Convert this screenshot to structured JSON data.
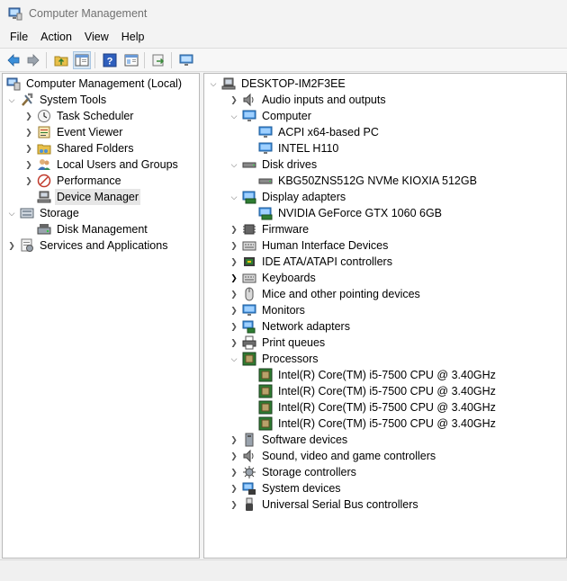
{
  "window": {
    "title": "Computer Management"
  },
  "menu": [
    "File",
    "Action",
    "View",
    "Help"
  ],
  "toolbar": {
    "buttons": [
      "back-arrow-icon",
      "forward-arrow-icon",
      "up-folder-icon",
      "show-hide-console-tree-icon",
      "help-icon",
      "properties-icon",
      "export-list-icon",
      "monitor-icon"
    ]
  },
  "left_tree": {
    "root": "Computer Management (Local)",
    "system_tools": "System Tools",
    "task_scheduler": "Task Scheduler",
    "event_viewer": "Event Viewer",
    "shared_folders": "Shared Folders",
    "local_users": "Local Users and Groups",
    "performance": "Performance",
    "device_manager": "Device Manager",
    "storage": "Storage",
    "disk_management": "Disk Management",
    "services": "Services and Applications"
  },
  "device_tree": {
    "root": "DESKTOP-IM2F3EE",
    "audio": "Audio inputs and outputs",
    "computer": "Computer",
    "computer_children": [
      "ACPI x64-based PC",
      "INTEL H110"
    ],
    "disk_drives": "Disk drives",
    "disk_children": [
      "KBG50ZNS512G NVMe KIOXIA 512GB"
    ],
    "display_adapters": "Display adapters",
    "display_children": [
      "NVIDIA GeForce GTX 1060 6GB"
    ],
    "firmware": "Firmware",
    "hid": "Human Interface Devices",
    "ide": "IDE ATA/ATAPI controllers",
    "keyboards": "Keyboards",
    "mice": "Mice and other pointing devices",
    "monitors": "Monitors",
    "network": "Network adapters",
    "print_queues": "Print queues",
    "processors": "Processors",
    "processor_children": [
      "Intel(R) Core(TM) i5-7500 CPU @ 3.40GHz",
      "Intel(R) Core(TM) i5-7500 CPU @ 3.40GHz",
      "Intel(R) Core(TM) i5-7500 CPU @ 3.40GHz",
      "Intel(R) Core(TM) i5-7500 CPU @ 3.40GHz"
    ],
    "software_devices": "Software devices",
    "sound": "Sound, video and game controllers",
    "storage_controllers": "Storage controllers",
    "system_devices": "System devices",
    "usb": "Universal Serial Bus controllers"
  }
}
